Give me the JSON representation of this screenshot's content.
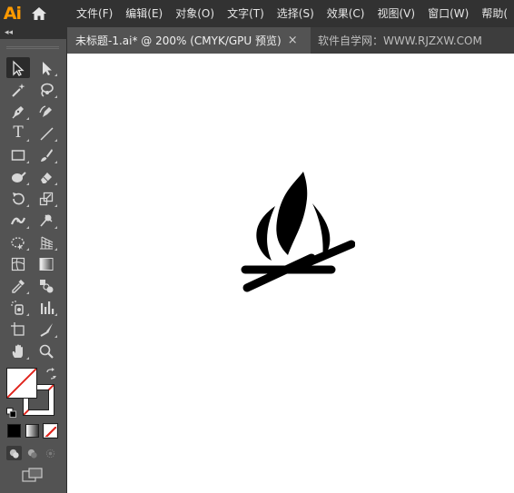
{
  "app": {
    "logo_text": "Ai",
    "accent_color": "#ff9a00"
  },
  "menu": {
    "items": [
      {
        "id": "file",
        "label": "文件(F)"
      },
      {
        "id": "edit",
        "label": "编辑(E)"
      },
      {
        "id": "object",
        "label": "对象(O)"
      },
      {
        "id": "type",
        "label": "文字(T)"
      },
      {
        "id": "select",
        "label": "选择(S)"
      },
      {
        "id": "effect",
        "label": "效果(C)"
      },
      {
        "id": "view",
        "label": "视图(V)"
      },
      {
        "id": "window",
        "label": "窗口(W)"
      },
      {
        "id": "help",
        "label": "帮助("
      }
    ]
  },
  "document_tab": {
    "title": "未标题-1.ai* @ 200% (CMYK/GPU 预览)",
    "close_glyph": "×"
  },
  "watermark_text": "软件自学网：WWW.RJZXW.COM",
  "toolbar": {
    "collapse_glyph": "◂◂",
    "tools": [
      {
        "id": "selection",
        "icon": "selection-arrow-icon",
        "selected": true
      },
      {
        "id": "direct-selection",
        "icon": "direct-selection-arrow-icon"
      },
      {
        "id": "magic-wand",
        "icon": "magic-wand-icon"
      },
      {
        "id": "lasso",
        "icon": "lasso-icon"
      },
      {
        "id": "pen",
        "icon": "pen-icon"
      },
      {
        "id": "curvature",
        "icon": "curvature-icon"
      },
      {
        "id": "type",
        "icon": "type-icon",
        "glyph": "T"
      },
      {
        "id": "line",
        "icon": "line-segment-icon"
      },
      {
        "id": "rectangle",
        "icon": "rectangle-icon"
      },
      {
        "id": "paintbrush",
        "icon": "paintbrush-icon"
      },
      {
        "id": "shaper",
        "icon": "shaper-icon"
      },
      {
        "id": "eraser",
        "icon": "eraser-icon"
      },
      {
        "id": "rotate",
        "icon": "rotate-icon"
      },
      {
        "id": "scale",
        "icon": "scale-icon"
      },
      {
        "id": "width",
        "icon": "width-icon"
      },
      {
        "id": "puppet-warp",
        "icon": "puppet-warp-icon"
      },
      {
        "id": "free-transform",
        "icon": "free-transform-icon"
      },
      {
        "id": "perspective-grid",
        "icon": "perspective-grid-icon"
      },
      {
        "id": "mesh",
        "icon": "mesh-icon"
      },
      {
        "id": "gradient",
        "icon": "gradient-icon"
      },
      {
        "id": "eyedropper",
        "icon": "eyedropper-icon"
      },
      {
        "id": "blend",
        "icon": "blend-icon"
      },
      {
        "id": "symbol-sprayer",
        "icon": "symbol-sprayer-icon"
      },
      {
        "id": "column-graph",
        "icon": "column-graph-icon"
      },
      {
        "id": "artboard",
        "icon": "artboard-icon"
      },
      {
        "id": "slice",
        "icon": "slice-icon"
      },
      {
        "id": "hand",
        "icon": "hand-icon"
      },
      {
        "id": "zoom",
        "icon": "zoom-icon"
      }
    ],
    "fill_color": "#ffffff",
    "stroke_color": "none",
    "none_indicator_color": "#e0231b"
  },
  "canvas": {
    "background": "#ffffff",
    "artwork": "campfire-icon",
    "artwork_color": "#000000"
  }
}
